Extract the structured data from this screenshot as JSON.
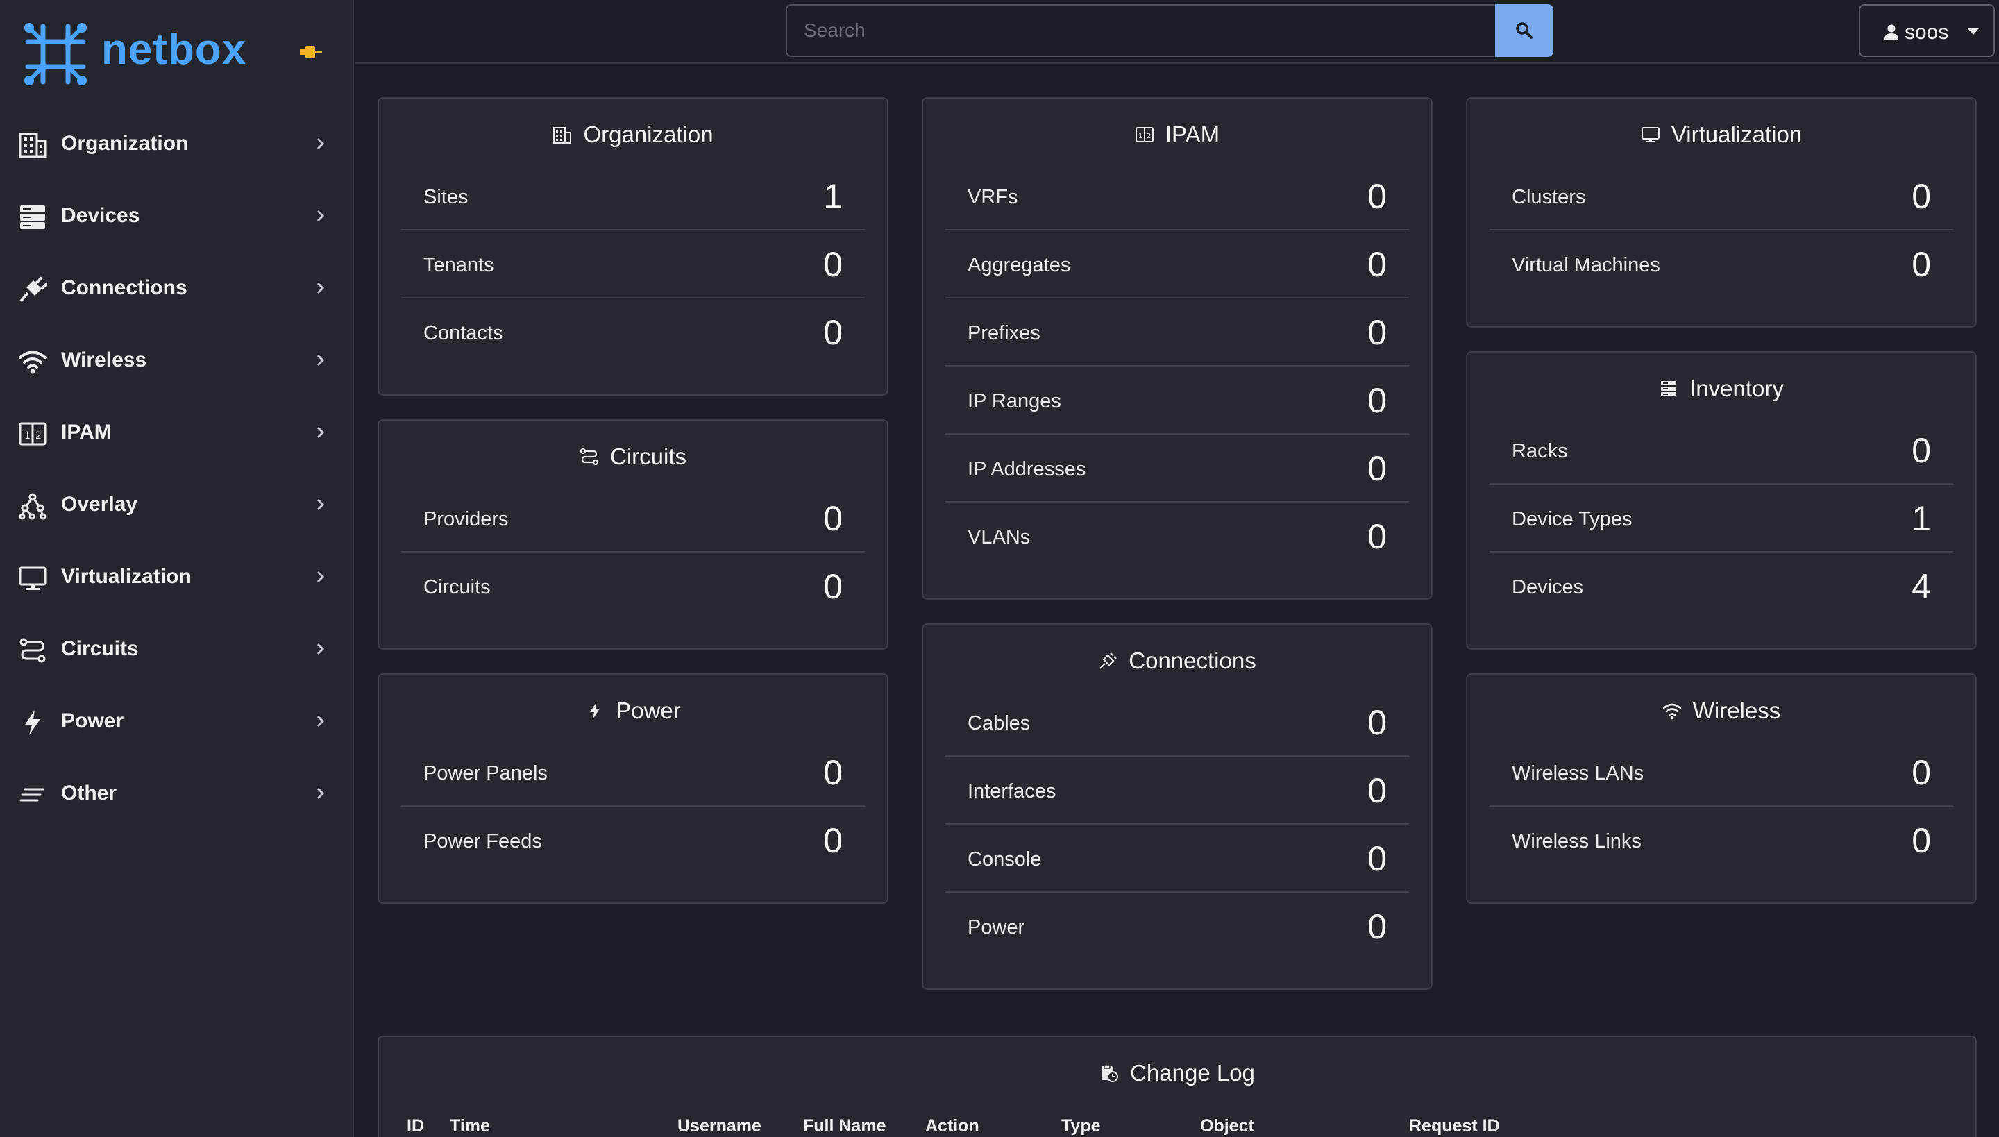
{
  "brand": {
    "name": "netbox"
  },
  "sidebar": {
    "items": [
      {
        "label": "Organization",
        "icon": "building-icon"
      },
      {
        "label": "Devices",
        "icon": "server-icon"
      },
      {
        "label": "Connections",
        "icon": "plug-icon"
      },
      {
        "label": "Wireless",
        "icon": "wifi-icon"
      },
      {
        "label": "IPAM",
        "icon": "counter-icon"
      },
      {
        "label": "Overlay",
        "icon": "graph-icon"
      },
      {
        "label": "Virtualization",
        "icon": "monitor-icon"
      },
      {
        "label": "Circuits",
        "icon": "transit-icon"
      },
      {
        "label": "Power",
        "icon": "lightning-icon"
      },
      {
        "label": "Other",
        "icon": "notes-icon"
      }
    ]
  },
  "search": {
    "placeholder": "Search"
  },
  "user": {
    "name": "soos"
  },
  "cards": {
    "organization": {
      "title": "Organization",
      "rows": [
        {
          "label": "Sites",
          "value": "1"
        },
        {
          "label": "Tenants",
          "value": "0"
        },
        {
          "label": "Contacts",
          "value": "0"
        }
      ]
    },
    "circuits": {
      "title": "Circuits",
      "rows": [
        {
          "label": "Providers",
          "value": "0"
        },
        {
          "label": "Circuits",
          "value": "0"
        }
      ]
    },
    "power": {
      "title": "Power",
      "rows": [
        {
          "label": "Power Panels",
          "value": "0"
        },
        {
          "label": "Power Feeds",
          "value": "0"
        }
      ]
    },
    "ipam": {
      "title": "IPAM",
      "rows": [
        {
          "label": "VRFs",
          "value": "0"
        },
        {
          "label": "Aggregates",
          "value": "0"
        },
        {
          "label": "Prefixes",
          "value": "0"
        },
        {
          "label": "IP Ranges",
          "value": "0"
        },
        {
          "label": "IP Addresses",
          "value": "0"
        },
        {
          "label": "VLANs",
          "value": "0"
        }
      ]
    },
    "connections": {
      "title": "Connections",
      "rows": [
        {
          "label": "Cables",
          "value": "0"
        },
        {
          "label": "Interfaces",
          "value": "0"
        },
        {
          "label": "Console",
          "value": "0"
        },
        {
          "label": "Power",
          "value": "0"
        }
      ]
    },
    "virtualization": {
      "title": "Virtualization",
      "rows": [
        {
          "label": "Clusters",
          "value": "0"
        },
        {
          "label": "Virtual Machines",
          "value": "0"
        }
      ]
    },
    "inventory": {
      "title": "Inventory",
      "rows": [
        {
          "label": "Racks",
          "value": "0"
        },
        {
          "label": "Device Types",
          "value": "1"
        },
        {
          "label": "Devices",
          "value": "4"
        }
      ]
    },
    "wireless": {
      "title": "Wireless",
      "rows": [
        {
          "label": "Wireless LANs",
          "value": "0"
        },
        {
          "label": "Wireless Links",
          "value": "0"
        }
      ]
    }
  },
  "changelog": {
    "title": "Change Log",
    "columns": [
      "ID",
      "Time",
      "Username",
      "Full Name",
      "Action",
      "Type",
      "Object",
      "Request ID"
    ]
  },
  "colors": {
    "accent": "#4aa3ff",
    "search_button": "#7aaaf0",
    "pin": "#f0b429"
  }
}
